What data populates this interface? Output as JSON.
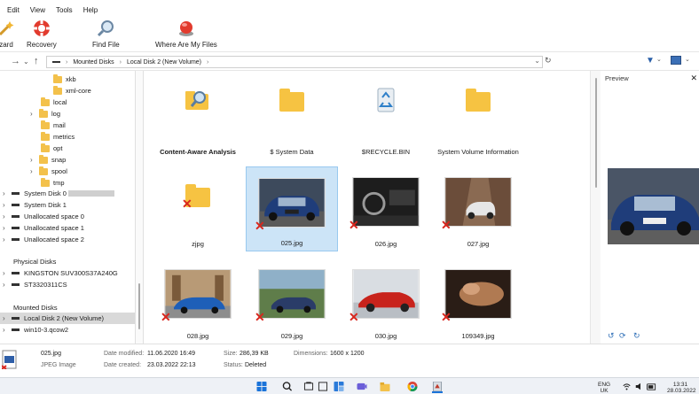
{
  "menu": [
    "Edit",
    "View",
    "Tools",
    "Help"
  ],
  "toolbar": {
    "wizard": "zard",
    "recovery": "Recovery",
    "find_file": "Find File",
    "where_files": "Where Are My Files"
  },
  "address": {
    "segments": [
      "Mounted Disks",
      "Local Disk 2 (New Volume)"
    ]
  },
  "sidebar": {
    "folders": [
      "xkb",
      "xml-core",
      "local",
      "log",
      "mail",
      "metrics",
      "opt",
      "snap",
      "spool",
      "tmp"
    ],
    "disks": [
      "System Disk 0",
      "System Disk 1",
      "Unallocated space 0",
      "Unallocated space 1",
      "Unallocated space 2"
    ],
    "physical_title": "Physical Disks",
    "physical": [
      "KINGSTON SUV300S37A240G",
      "ST3320311CS"
    ],
    "mounted_title": "Mounted Disks",
    "mounted": [
      "Local Disk 2 (New Volume)",
      "win10-3.qcow2"
    ]
  },
  "items": [
    {
      "label": "Content-Aware Analysis",
      "type": "search"
    },
    {
      "label": "$ System Data",
      "type": "folder"
    },
    {
      "label": "$RECYCLE.BIN",
      "type": "recycle"
    },
    {
      "label": "System Volume Information",
      "type": "folder"
    },
    {
      "label": "zjpg",
      "type": "folder-deleted"
    },
    {
      "label": "025.jpg",
      "type": "photo",
      "selected": true
    },
    {
      "label": "026.jpg",
      "type": "photo"
    },
    {
      "label": "027.jpg",
      "type": "photo"
    },
    {
      "label": "028.jpg",
      "type": "photo"
    },
    {
      "label": "029.jpg",
      "type": "photo"
    },
    {
      "label": "030.jpg",
      "type": "photo"
    },
    {
      "label": "109349.jpg",
      "type": "photo"
    }
  ],
  "preview": {
    "title": "Preview"
  },
  "status": {
    "file_name": "025.jpg",
    "file_type": "JPEG Image",
    "date_modified_label": "Date modified:",
    "date_modified": "11.06.2020 16:49",
    "date_created_label": "Date created:",
    "date_created": "23.03.2022 22:13",
    "size_label": "Size:",
    "size": "286,39 KB",
    "status_label": "Status:",
    "status": "Deleted",
    "dimensions_label": "Dimensions:",
    "dimensions": "1600 x 1200"
  },
  "tray": {
    "lang": "ENG",
    "region": "UK",
    "time": "13:31",
    "date": "28.03.2022"
  },
  "colors": {
    "accent": "#cce4f7",
    "deleted": "#d8261d",
    "folder": "#f6c342"
  }
}
